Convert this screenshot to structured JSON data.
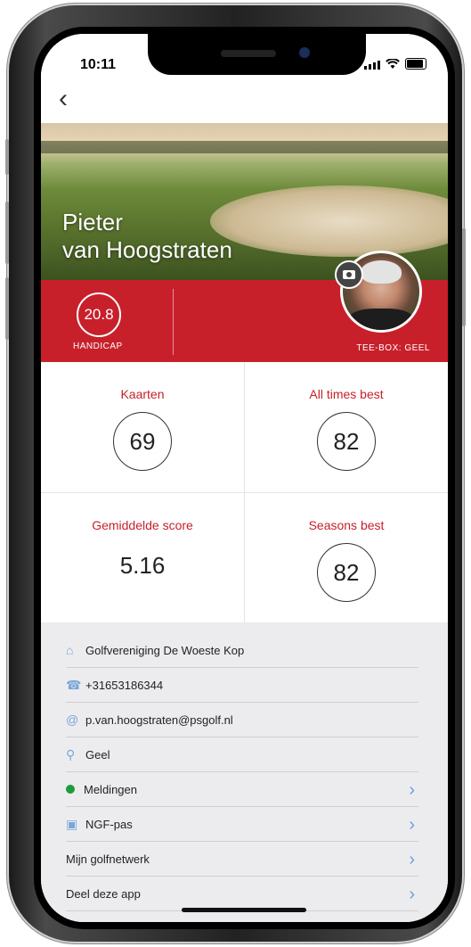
{
  "status": {
    "time": "10:11"
  },
  "profile": {
    "first_name": "Pieter",
    "last_name": "van Hoogstraten",
    "handicap": "20.8",
    "handicap_label": "HANDICAP",
    "tee_box": "TEE-BOX: GEEL"
  },
  "stats": [
    {
      "label": "Kaarten",
      "value": "69"
    },
    {
      "label": "All times best",
      "value": "82"
    },
    {
      "label": "Gemiddelde score",
      "value": "5.16"
    },
    {
      "label": "Seasons best",
      "value": "82"
    }
  ],
  "info": {
    "club": "Golfvereniging De Woeste Kop",
    "phone": "+31653186344",
    "email": "p.van.hoogstraten@psgolf.nl",
    "location": "Geel",
    "notifications": "Meldingen",
    "ngf_pass": "NGF-pas",
    "network": "Mijn golfnetwerk",
    "share": "Deel deze app"
  },
  "icons": {
    "back": "chevron-left-icon",
    "club": "home-icon",
    "phone": "phone-icon",
    "email": "at-icon",
    "location": "location-pin-icon",
    "notifications": "status-dot",
    "ngf_pass": "id-card-icon",
    "chevron": "chevron-right-icon",
    "camera": "camera-icon"
  },
  "colors": {
    "brand_red": "#c8202b",
    "link_blue": "#6aa0d8",
    "status_green": "#1e9c3a"
  }
}
